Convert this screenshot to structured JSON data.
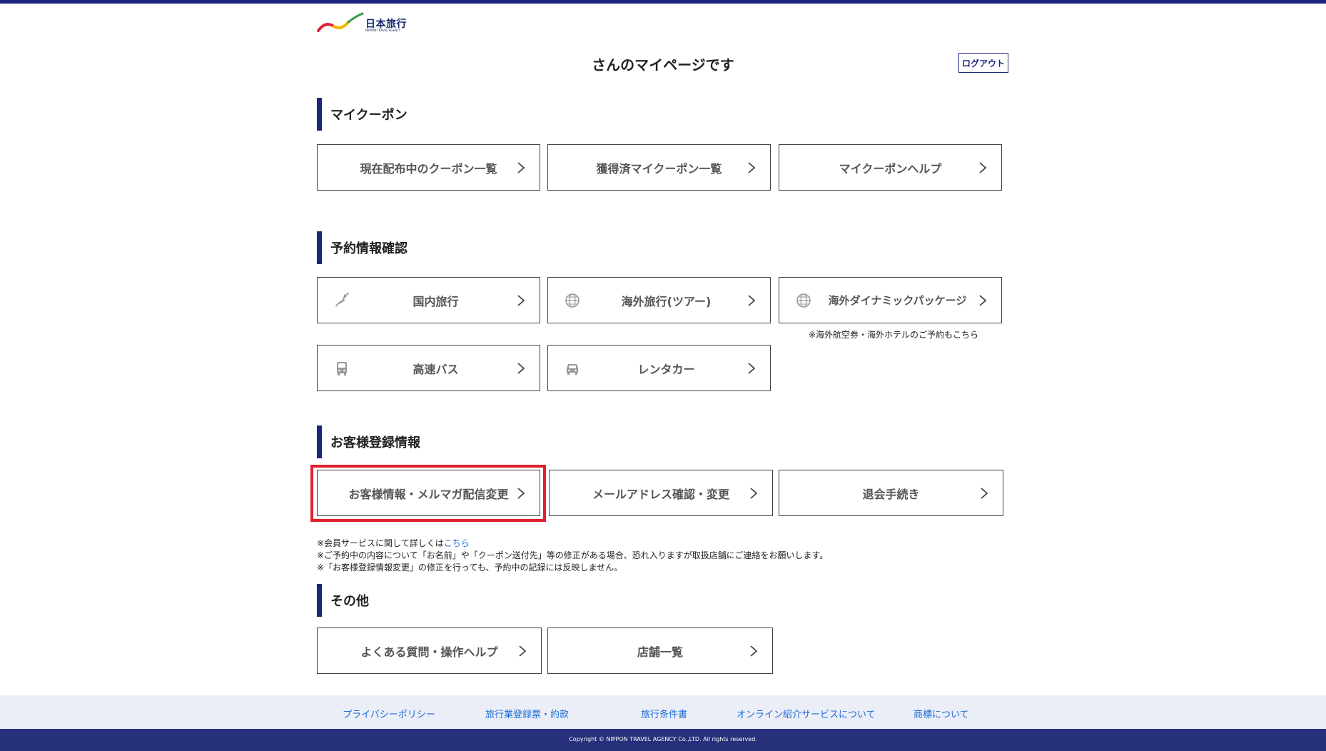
{
  "header": {
    "logo_text": "日本旅行",
    "logo_subtext": "NIPPON TRAVEL AGENCY",
    "page_title": "さんのマイページです",
    "logout_label": "ログアウト"
  },
  "sections": {
    "coupon": {
      "title": "マイクーポン",
      "items": [
        {
          "label": "現在配布中のクーポン一覧"
        },
        {
          "label": "獲得済マイクーポン一覧"
        },
        {
          "label": "マイクーポンヘルプ"
        }
      ]
    },
    "reservation": {
      "title": "予約情報確認",
      "items": [
        {
          "label": "国内旅行",
          "icon": "japan-map-icon"
        },
        {
          "label": "海外旅行(ツアー)",
          "icon": "globe-icon"
        },
        {
          "label": "海外ダイナミックパッケージ",
          "icon": "globe-icon"
        },
        {
          "label": "高速バス",
          "icon": "bus-icon"
        },
        {
          "label": "レンタカー",
          "icon": "car-icon"
        }
      ],
      "note": "※海外航空券・海外ホテルのご予約もこちら"
    },
    "customer": {
      "title": "お客様登録情報",
      "items": [
        {
          "label": "お客様情報・メルマガ配信変更"
        },
        {
          "label": "メールアドレス確認・変更"
        },
        {
          "label": "退会手続き"
        }
      ],
      "notes": {
        "line1_prefix": "※会員サービスに関して詳しくは",
        "line1_link": "こちら",
        "line2": "※ご予約中の内容について「お名前」や「クーポン送付先」等の修正がある場合、恐れ入りますが取扱店舗にご連絡をお願いします。",
        "line3": "※「お客様登録情報変更」の修正を行っても、予約中の記録には反映しません。"
      }
    },
    "other": {
      "title": "その他",
      "items": [
        {
          "label": "よくある質問・操作ヘルプ"
        },
        {
          "label": "店舗一覧"
        }
      ]
    }
  },
  "footer": {
    "links": [
      "プライバシーポリシー",
      "旅行業登録票・約款",
      "旅行条件書",
      "オンライン紹介サービスについて",
      "商標について"
    ],
    "copyright": "Copyright © NIPPON TRAVEL AGENCY Co.,LTD. All rights reserved."
  },
  "colors": {
    "brand_navy": "#1c2580",
    "highlight_red": "#e0202c",
    "link_blue": "#1a6bd6",
    "footer_bg": "#eceef7"
  }
}
